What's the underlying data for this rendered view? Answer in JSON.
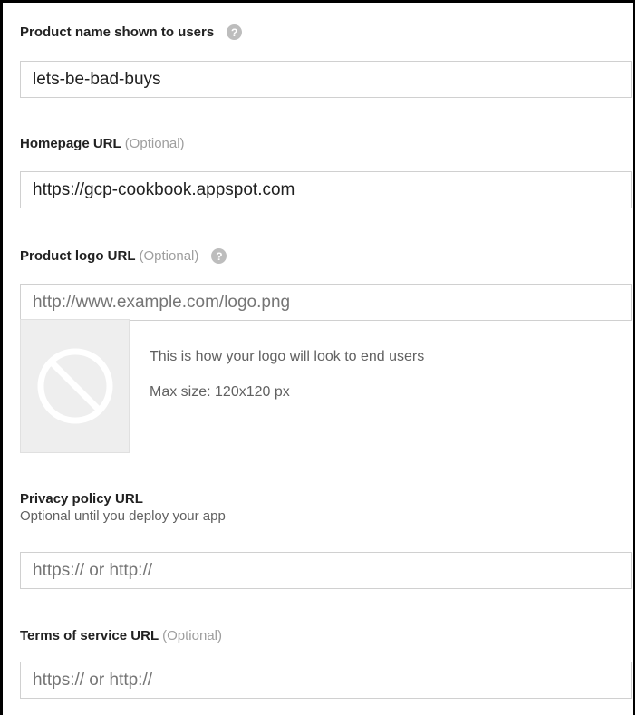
{
  "product_name": {
    "label": "Product name shown to users",
    "value": "lets-be-bad-buys"
  },
  "homepage": {
    "label": "Homepage URL",
    "optional": "(Optional)",
    "value": "https://gcp-cookbook.appspot.com"
  },
  "logo_url": {
    "label": "Product logo URL",
    "optional": "(Optional)",
    "placeholder": "http://www.example.com/logo.png",
    "preview_caption": "This is how your logo will look to end users",
    "max_size": "Max size: 120x120 px"
  },
  "privacy": {
    "label": "Privacy policy URL",
    "subtext": "Optional until you deploy your app",
    "placeholder": "https:// or http://"
  },
  "terms": {
    "label": "Terms of service URL",
    "optional": "(Optional)",
    "placeholder": "https:// or http://"
  },
  "colors": {
    "help_icon": "#bdbdbd",
    "optional_text": "#9e9e9e",
    "input_border": "#d0d0d0"
  }
}
